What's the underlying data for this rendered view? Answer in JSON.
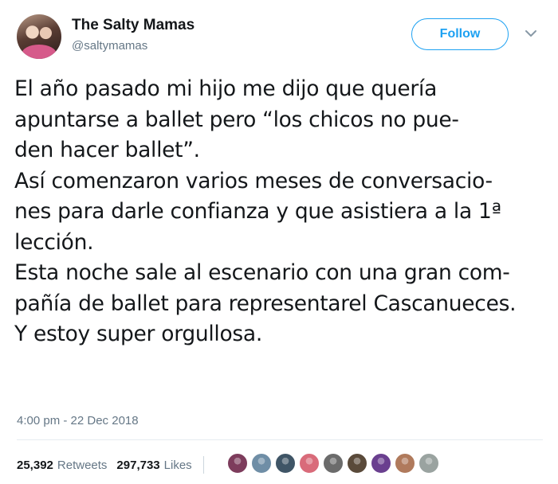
{
  "user": {
    "display_name": "The Salty Mamas",
    "handle": "@saltymamas",
    "follow_label": "Follow"
  },
  "tweet": {
    "lines": [
      "El año pasado mi hijo me dijo que quería",
      "apuntarse a ballet pero “los chicos no pue-",
      "den hacer ballet”.",
      "Así comenzaron varios meses de conversacio-",
      "nes para darle confianza y que asistiera a la 1ª",
      "lección.",
      "Esta noche sale al escenario con una gran com-",
      "pañía de ballet para representarel Cascanueces.",
      "Y estoy super orgullosa."
    ],
    "timestamp": "4:00 pm - 22 Dec 2018"
  },
  "stats": {
    "retweets_count": "25,392",
    "retweets_label": "Retweets",
    "likes_count": "297,733",
    "likes_label": "Likes"
  },
  "likers": [
    {
      "icon": "liker-avatar",
      "color": "#7d3c5c"
    },
    {
      "icon": "liker-avatar",
      "color": "#6f8ea6"
    },
    {
      "icon": "liker-avatar",
      "color": "#3f5566"
    },
    {
      "icon": "liker-avatar",
      "color": "#d96b7a"
    },
    {
      "icon": "liker-avatar",
      "color": "#6b6b6b"
    },
    {
      "icon": "liker-avatar",
      "color": "#5a4a3a"
    },
    {
      "icon": "liker-avatar",
      "color": "#6a3f8f"
    },
    {
      "icon": "liker-avatar",
      "color": "#b07a5c"
    },
    {
      "icon": "liker-avatar",
      "color": "#9aa3a0"
    }
  ],
  "colors": {
    "accent": "#1da1f2",
    "text": "#14171a",
    "muted": "#657786"
  },
  "icons": {
    "menu": "chevron-down-icon"
  }
}
